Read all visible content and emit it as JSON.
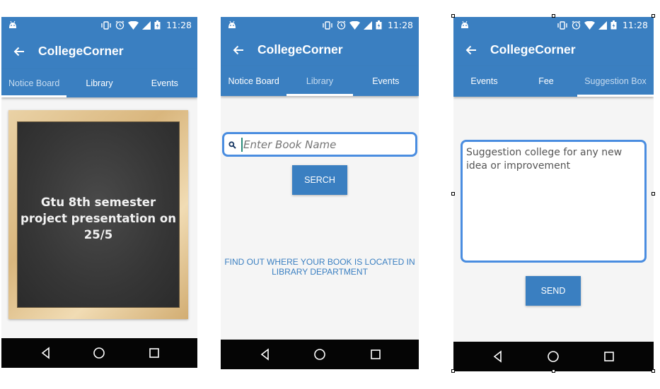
{
  "status_bar": {
    "time": "11:28"
  },
  "app": {
    "title": "CollegeCorner"
  },
  "screen1": {
    "tabs": [
      {
        "label": "Notice Board",
        "selected": true
      },
      {
        "label": "Library"
      },
      {
        "label": "Events"
      }
    ],
    "notice": {
      "text": "Gtu 8th semester project presentation on 25/5"
    }
  },
  "screen2": {
    "tabs": [
      {
        "label": "Notice Board"
      },
      {
        "label": "Library",
        "selected": true
      },
      {
        "label": "Events"
      }
    ],
    "search": {
      "placeholder": "Enter Book Name",
      "button": "SERCH"
    },
    "info_line1": "FIND OUT WHERE YOUR BOOK IS LOCATED IN",
    "info_line2": "LIBRARY DEPARTMENT"
  },
  "screen3": {
    "tabs": [
      {
        "label": "Events"
      },
      {
        "label": "Fee"
      },
      {
        "label": "Suggestion Box",
        "selected": true
      }
    ],
    "suggestion": {
      "line1": "Suggestion college for any new",
      "line2": "idea or improvement"
    },
    "send_button": "SEND"
  },
  "colors": {
    "primary": "#3a7fc1",
    "accent_border": "#4a8de0",
    "nav_bar": "#050505"
  }
}
